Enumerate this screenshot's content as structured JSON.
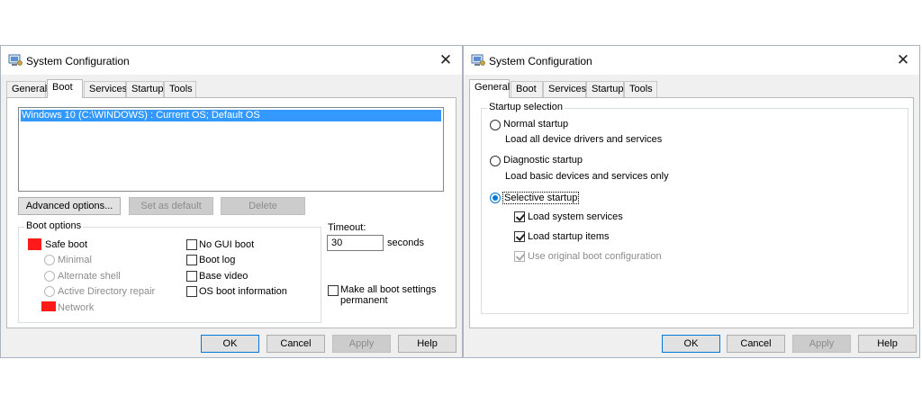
{
  "left_window": {
    "title": "System Configuration",
    "tabs": [
      "General",
      "Boot",
      "Services",
      "Startup",
      "Tools"
    ],
    "active_tab": "Boot",
    "os_list": [
      "Windows 10 (C:\\WINDOWS) : Current OS; Default OS"
    ],
    "buttons": {
      "advanced": "Advanced options...",
      "set_default": "Set as default",
      "delete": "Delete"
    },
    "boot_options": {
      "title": "Boot options",
      "safe_boot": "Safe boot",
      "minimal": "Minimal",
      "alternate_shell": "Alternate shell",
      "ad_repair": "Active Directory repair",
      "network": "Network",
      "no_gui_boot": "No GUI boot",
      "boot_log": "Boot log",
      "base_video": "Base video",
      "os_boot_info": "OS boot information"
    },
    "timeout": {
      "label": "Timeout:",
      "value": "30",
      "unit": "seconds"
    },
    "make_permanent_line1": "Make all boot settings",
    "make_permanent_line2": "permanent",
    "footer": {
      "ok": "OK",
      "cancel": "Cancel",
      "apply": "Apply",
      "help": "Help"
    }
  },
  "right_window": {
    "title": "System Configuration",
    "tabs": [
      "General",
      "Boot",
      "Services",
      "Startup",
      "Tools"
    ],
    "active_tab": "General",
    "startup_selection": {
      "title": "Startup selection",
      "normal": "Normal startup",
      "normal_desc": "Load all device drivers and services",
      "diagnostic": "Diagnostic startup",
      "diagnostic_desc": "Load basic devices and services only",
      "selective": "Selective startup",
      "load_services": "Load system services",
      "load_startup": "Load startup items",
      "use_original": "Use original boot configuration",
      "selected": "selective"
    },
    "footer": {
      "ok": "OK",
      "cancel": "Cancel",
      "apply": "Apply",
      "help": "Help"
    }
  },
  "colors": {
    "selection": "#3399ff",
    "radio_accent": "#0078d7",
    "redaction": "#ff1a1a"
  },
  "icons": [
    "app-icon",
    "close-icon"
  ]
}
